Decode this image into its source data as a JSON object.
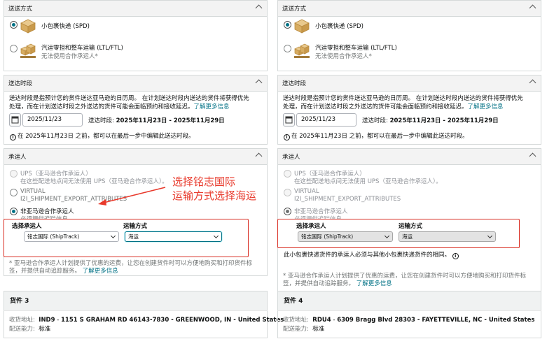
{
  "annotation": {
    "line1": "选择铭志国际",
    "line2": "运输方式选择海运"
  },
  "panels": [
    {
      "shipping_method": {
        "title": "送送方式",
        "options": [
          {
            "label": "小包裹快递 (SPD)",
            "sublabel": "",
            "selected": true
          },
          {
            "label": "汽运零担和整车运输 (LTL/FTL)",
            "sublabel": "无法使用合作承运人*",
            "selected": false
          }
        ]
      },
      "delivery_window": {
        "title": "送达时段",
        "description_1": "送达时段是指预计您的货件送达亚马逊的日历周。 在计划送达时段内送达的货件将获得优先",
        "description_2": "处理，而在计划送达时段之外送达的货件可能会面临预约和接收延迟。",
        "learn_more": "了解更多信息",
        "date_value": "2025/11/23",
        "window_label": "送达时段:",
        "window_value": "2025年11月23日 - 2025年11月29日",
        "edit_note": "在 2025年11月23日 之前，都可以在最后一步中编辑此送达时段。"
      },
      "carrier": {
        "title": "承运人",
        "options": [
          {
            "label": "UPS（亚马逊合作承运人）",
            "sublabel": "在这些配送地点间无法使用 UPS（亚马逊合作承运人）。",
            "state": "disabled"
          },
          {
            "label": "VIRTUAL",
            "sublabel": "I2I_SHIPMENT_EXPORT_ATTRIBUTES",
            "state": "unselected"
          },
          {
            "label": "非亚马逊合作承运人",
            "sublabel": "必须提供追踪信息",
            "state": "selected"
          }
        ],
        "select_carrier_label": "选择承运人",
        "shipping_mode_label": "运输方式",
        "carrier_value": "铭志国际 (ShipTrack)",
        "mode_value": "海运",
        "warning": "",
        "footnote_1": "* 亚马逊合作承运人计划提供了优惠的运费，让您在创建货件时可以方便地购买和打印货件标",
        "footnote_2": "签，并提供自动追踪服务。",
        "footnote_link": "了解更多信息"
      },
      "shipment": {
        "title": "货件 3",
        "address_label": "收货地址:",
        "address_code": "IND9",
        "address_value": "1151 S GRAHAM RD  46143-7830 - GREENWOOD, IN - United States",
        "capability_label": "配送能力:",
        "capability_value": "标准"
      }
    },
    {
      "shipping_method": {
        "title": "送送方式",
        "options": [
          {
            "label": "小包裹快递 (SPD)",
            "sublabel": "",
            "selected": true
          },
          {
            "label": "汽运零担和整车运输 (LTL/FTL)",
            "sublabel": "无法使用合作承运人*",
            "selected": false
          }
        ]
      },
      "delivery_window": {
        "title": "送达时段",
        "description_1": "送达时段是指预计您的货件送达亚马逊的日历周。 在计划送达时段内送达的货件将获得优先",
        "description_2": "处理，而在计划送达时段之外送达的货件可能会面临预约和接收延迟。",
        "learn_more": "了解更多信息",
        "date_value": "2025/11/23",
        "window_label": "送达时段:",
        "window_value": "2025年11月23日 - 2025年11月29日",
        "edit_note": "在 2025年11月23日 之前，都可以在最后一步中编辑此送达时段。"
      },
      "carrier": {
        "title": "承运人",
        "options": [
          {
            "label": "UPS（亚马逊合作承运人）",
            "sublabel": "在这些配送地点间无法使用 UPS（亚马逊合作承运人）。",
            "state": "disabled"
          },
          {
            "label": "VIRTUAL",
            "sublabel": "I2I_SHIPMENT_EXPORT_ATTRIBUTES",
            "state": "unselected"
          },
          {
            "label": "非亚马逊合作承运人",
            "sublabel": "必须提供追踪信息",
            "state": "selected"
          }
        ],
        "select_carrier_label": "选择承运人",
        "shipping_mode_label": "运输方式",
        "carrier_value": "铭志国际 (ShipTrack)",
        "mode_value": "海运",
        "warning": "此小包裹快递货件的承运人必须与其他小包裹快递货件的相同。",
        "footnote_1": "* 亚马逊合作承运人计划提供了优惠的运费，让您在创建货件时可以方便地购买和打印货件标",
        "footnote_2": "签，并提供自动追踪服务。",
        "footnote_link": "了解更多信息"
      },
      "shipment": {
        "title": "货件 4",
        "address_label": "收货地址:",
        "address_code": "RDU4",
        "address_value": "6309 Bragg Blvd  28303 - FAYETTEVILLE, NC - United States",
        "capability_label": "配送能力:",
        "capability_value": "标准"
      }
    }
  ]
}
